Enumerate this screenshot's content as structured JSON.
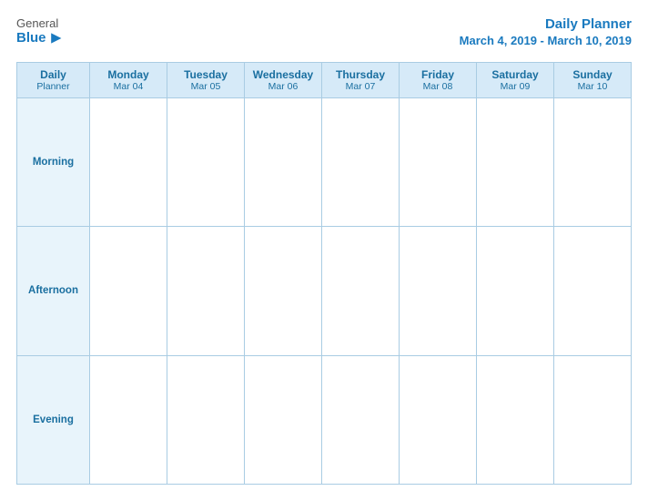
{
  "logo": {
    "general": "General",
    "blue": "Blue",
    "icon": "▶"
  },
  "title": "Daily Planner",
  "dates": "March 4, 2019 - March 10, 2019",
  "columns": [
    {
      "id": "label",
      "day": "Daily",
      "sub": "Planner",
      "date": ""
    },
    {
      "id": "mon",
      "day": "Monday",
      "sub": "",
      "date": "Mar 04"
    },
    {
      "id": "tue",
      "day": "Tuesday",
      "sub": "",
      "date": "Mar 05"
    },
    {
      "id": "wed",
      "day": "Wednesday",
      "sub": "",
      "date": "Mar 06"
    },
    {
      "id": "thu",
      "day": "Thursday",
      "sub": "",
      "date": "Mar 07"
    },
    {
      "id": "fri",
      "day": "Friday",
      "sub": "",
      "date": "Mar 08"
    },
    {
      "id": "sat",
      "day": "Saturday",
      "sub": "",
      "date": "Mar 09"
    },
    {
      "id": "sun",
      "day": "Sunday",
      "sub": "",
      "date": "Mar 10"
    }
  ],
  "rows": [
    {
      "label": "Morning"
    },
    {
      "label": "Afternoon"
    },
    {
      "label": "Evening"
    }
  ]
}
